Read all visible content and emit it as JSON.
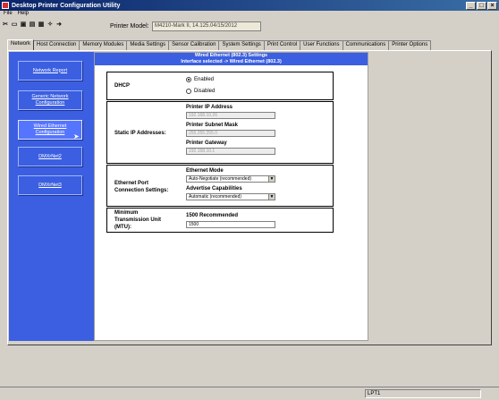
{
  "window": {
    "title": "Desktop Printer Configuration Utility",
    "min": "_",
    "max": "□",
    "close": "×"
  },
  "menu": {
    "file": "File",
    "help": "Help"
  },
  "toolbar_icons": [
    "new-icon",
    "open-icon",
    "save-icon",
    "print-icon",
    "refresh-icon",
    "settings-icon",
    "help-icon"
  ],
  "printer": {
    "label": "Printer Model:",
    "value": "M4210-Mark II, 14.125.04/15/2012"
  },
  "tabs": [
    "Network",
    "Host Connection",
    "Memory Modules",
    "Media Settings",
    "Sensor Calibration",
    "System Settings",
    "Print Control",
    "User Functions",
    "Communications",
    "Printer Options"
  ],
  "sidebar": {
    "items": [
      "Network Report",
      "Generic Network Configuration",
      "Wired Ethernet Configuration",
      "DMXrNet2",
      "DMXrNet3"
    ]
  },
  "header": {
    "line1": "Wired Ethernet (802.3) Settings",
    "line2": "Interface selected -> Wired Ethernet (802.3)"
  },
  "dhcp": {
    "label": "DHCP",
    "enabled": "Enabled",
    "disabled": "Disabled"
  },
  "static_ip": {
    "label": "Static IP Addresses:",
    "ip_label": "Printer IP Address",
    "ip_value": "192.168.10.26",
    "mask_label": "Printer Subnet Mask",
    "mask_value": "255.255.255.0",
    "gw_label": "Printer Gateway",
    "gw_value": "192.168.10.1"
  },
  "ethernet_port": {
    "label_line1": "Ethernet Port",
    "label_line2": "Connection Settings:",
    "mode_label": "Ethernet Mode",
    "mode_value": "Auto-Negotiate (recommended)",
    "adv_label": "Advertise Capabilities",
    "adv_value": "Automatic (recommended)"
  },
  "mtu": {
    "label_line1": "Minimum",
    "label_line2": "Transmission Unit",
    "label_line3": "(MTU):",
    "rec_label": "1500 Recommended",
    "value": "1500"
  },
  "status": {
    "port": "LPT1"
  }
}
